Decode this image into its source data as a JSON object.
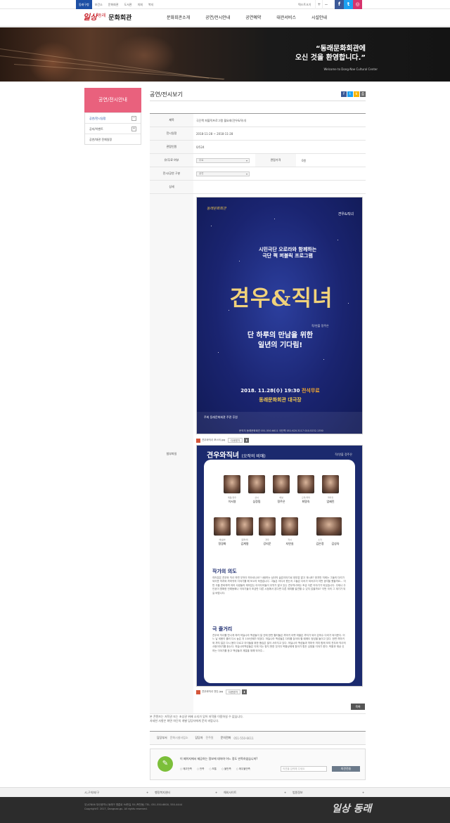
{
  "topbar": {
    "links": [
      "동래구청",
      "보건소",
      "문화회관",
      "도서관",
      "의회",
      "복지"
    ],
    "text_size_label": "텍스트크기",
    "zoom_in": "+",
    "zoom_out": "−",
    "sns": [
      "f",
      "t",
      "◎"
    ]
  },
  "header": {
    "logo_mark": "일상",
    "logo_mark2": "동래",
    "logo_name": "문화회관",
    "gnb": [
      "문화회관소개",
      "공연/전시안내",
      "공연예약",
      "대관서비스",
      "시설안내"
    ]
  },
  "hero": {
    "line1": "“동래문화회관에",
    "line2": "오신 것을 환영합니다.”",
    "sub": "Welcome to Dong-Nae Cultural Center"
  },
  "lnb": {
    "title": "공연/전시안내",
    "items": [
      "공연/전시일정",
      "공지/이벤트",
      "공연/대관 전체일정"
    ]
  },
  "content": {
    "title": "공연/전시보기",
    "share": [
      "f",
      "t",
      "k",
      "⎙"
    ],
    "rows": {
      "subject_label": "제목",
      "subject": "극단쩍 퍼블릭프로그램 월요회(견우&직녀)",
      "period_label": "전시일정",
      "period": "2018-11-28 ~ 2018-11-28",
      "views_label": "관람인원",
      "views": "0/524",
      "fee_label": "유/무료 여부",
      "fee_value": "무료",
      "price_label": "관람가격",
      "price_value": "0원",
      "category_label": "전시/공연 구분",
      "category_value": "공연",
      "detail_label": "상세",
      "attach_label": "첨부파일"
    },
    "poster1": {
      "badge": "동래문화회관",
      "badge2": "견우&직녀",
      "sub1": "시민극단 오로라와 함께하는",
      "sub2": "극단 쩍 퍼블릭 프로그램",
      "title": "견우&직녀",
      "author": "작/연출 정주은",
      "line1": "단 하루의 만남을 위한",
      "line2": "일년의 기다림!",
      "date": "2018. 11.28(수) 19:30",
      "free": "전석무료",
      "venue": "동래문화회관 대극장",
      "foot1": "주최  동래문화회관    주관    후원",
      "foot2": "문의처 동래문화회관 051.550.6611 극단쩍 051.620.3117 010.5232.1350"
    },
    "file1": {
      "name": "견우와직녀 포스터.jpg",
      "btn": "다운받기",
      "dl": "⬇"
    },
    "poster2": {
      "title": "견우와직녀",
      "title_sub": "(오작의 비애)",
      "author": "작/연출 정주은",
      "cast_row1": [
        {
          "role": "목동/견우",
          "name": "이서영"
        },
        {
          "role": "선녀",
          "name": "심정림"
        },
        {
          "role": "해설",
          "name": "정주은"
        },
        {
          "role": "오작/까마",
          "name": "최명숙"
        },
        {
          "role": "까마귀",
          "name": "엄혜린"
        }
      ],
      "cast_row2": [
        {
          "role": "해/봄바",
          "name": "정경화"
        },
        {
          "role": "동물/떡",
          "name": "김계령"
        },
        {
          "role": "견우",
          "name": "강지운"
        },
        {
          "role": "직녀",
          "name": "지연실"
        },
        {
          "role": "소작",
          "name": "김은정"
        },
        {
          "role": "",
          "name": "김성숙"
        }
      ],
      "section1": "작가의 의도",
      "text1": "여러분은 견우와 직녀 하면 무엇이 떠오르나요? 사람하는 남녀의 슬픈이야기로 대부분 알고 계시죠? 한지만 저희는 그들의 다리가 되어준 까치와 까마귀의 이야기를 해 보고자 하였습니다. 그들은 어디서 왔는지 그들은 다리가 되어주어 어떤 생각을 했을까요... 이번 극을 준비하며 여러 사람들의 재미있는 아이디어들이 무엇가 알고 있는 견우직녀와는 조금 다른 이야기가 되었습니다. 주제나 주인공이 명확한 전래동화나 이야기들이 조금만 다른 시점에서 본다면 다른 재미를 발견할 수 있지 않을까요? 이번 극의 그 계기가 되길 바랍니다.",
      "section2": "극 줄거리",
      "text2": "견우와 직녀를 만나게 하려 하늘나라 백성들이 일 년에 한번 할떠돌은 까마귀 아랫 마을은 까치가 되어 은하수 다리가 되어준다. 어느 날 세몸이 흘러 다시 높은 지 100년째가 되었다. 하늘나라 백성들은 다리를 놓아야 할 때에도 정성을 들이고 있다. 한편 까마귀와 까치 일은 다시 몸이 다르고 아이들을 위한 풍습은 많이 사라지고 있다. 하늘나라 백성들과 까마귀 까치 함께 모여 견우와 직녀의 사랑이야기를 듣는다. 하늘나라백성들은 이제 이는 정지 못한 것이다 옥황상제께 찾아가 힘든 심정을 이야기 한다. 옥황과 재상 신하는 이야기를 듣고 백성들과 계절을 위해 되어주..."
    },
    "file2": {
      "name": "견우와직녀 전단.jpg",
      "btn": "다운받기",
      "dl": "⬇"
    },
    "list_btn": "목록",
    "notice1": "본 콘텐츠는 저작권 또는 초상권 위배 소지가 있어 저작물 이용하실 수 없습니다.",
    "notice2": "자세한 사항은 화면 하단의 개별 담당자에게 문의 바랍니다.",
    "info": {
      "dept_label": "담당부서",
      "dept": "문화시설사업소",
      "person_label": "담당자",
      "person": "전주원",
      "tel_label": "문의전화",
      "tel": "051-550-6611"
    },
    "survey": {
      "question": "이 페이지에서 제공하는 정보에 대하여 어느 정도 만족하셨습니까?",
      "options": [
        "매우만족",
        "만족",
        "보통",
        "불만족",
        "매우불만족"
      ],
      "placeholder": "의견을 입력해 주세요",
      "submit": "의견전송"
    }
  },
  "footer": {
    "nav": [
      "시,구의회/구",
      "행정복지센터",
      "해외사이트",
      "법원정보"
    ],
    "addr1": "우)47806 부산광역시 동래구 명륜로 94번길 55 (복천동)  TEL. 051-550-6600, 550-4444",
    "addr2": "Copyright© 2017, Dongnae-gu. All rights reserved.",
    "logo": "일상 동래"
  }
}
